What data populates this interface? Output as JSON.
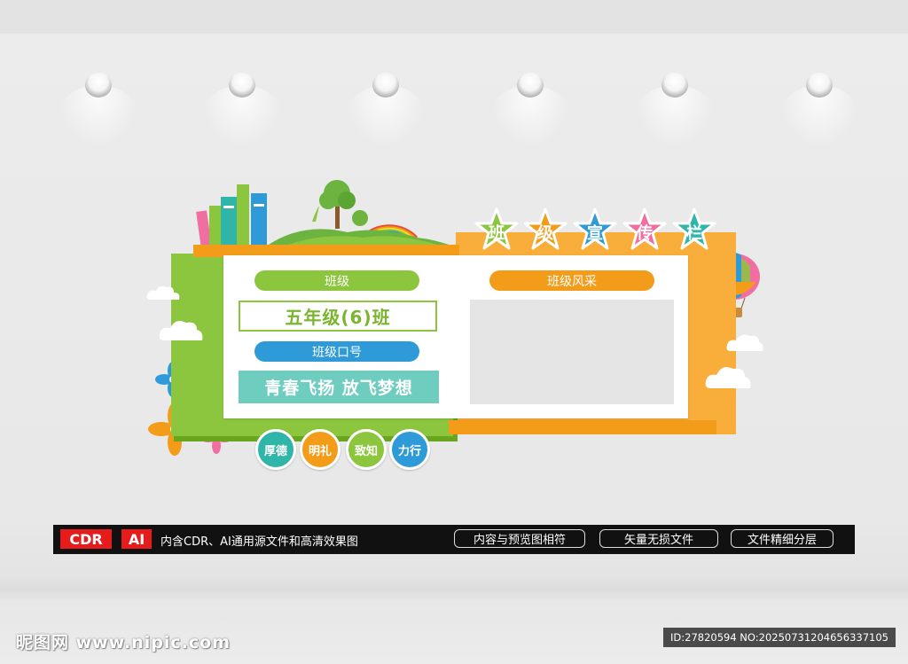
{
  "title_stars": [
    "班",
    "级",
    "宣",
    "传",
    "栏"
  ],
  "star_colors": [
    "#8cc63e",
    "#f39c1a",
    "#2e9ad8",
    "#f06fa0",
    "#2fb6a8"
  ],
  "class_label": "班级",
  "class_name": "五年级(6)班",
  "slogan_label": "班级口号",
  "slogan": "青春飞扬 放飞梦想",
  "gallery_label": "班级风采",
  "values": [
    {
      "text": "厚德",
      "color": "#2fb6a8"
    },
    {
      "text": "明礼",
      "color": "#f39c1a"
    },
    {
      "text": "致知",
      "color": "#8cc63e"
    },
    {
      "text": "力行",
      "color": "#2e9ad8"
    }
  ],
  "banner": {
    "tag_cdr": "CDR",
    "tag_ai": "AI",
    "text": "内含CDR、AI通用源文件和高清效果图",
    "features": [
      "内容与预览图相符",
      "矢量无损文件",
      "文件精细分层"
    ]
  },
  "watermark": "昵图网 www.nipic.com",
  "image_id": "ID:27820594 NO:20250731204656337105"
}
